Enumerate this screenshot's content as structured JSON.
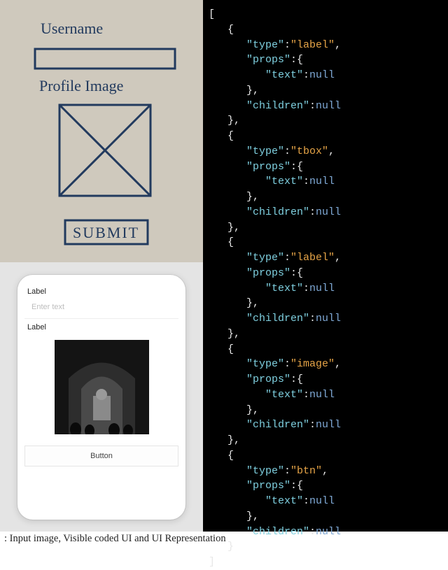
{
  "sketch": {
    "label_username": "Username",
    "label_profile_image": "Profile Image",
    "submit_button": "SUBMIT"
  },
  "phone_ui": {
    "label_1": "Label",
    "input_placeholder": "Enter text",
    "label_2": "Label",
    "button_text": "Button"
  },
  "code_tree": [
    {
      "type": "label",
      "props": {
        "text": null
      },
      "children": null
    },
    {
      "type": "tbox",
      "props": {
        "text": null
      },
      "children": null
    },
    {
      "type": "label",
      "props": {
        "text": null
      },
      "children": null
    },
    {
      "type": "image",
      "props": {
        "text": null
      },
      "children": null
    },
    {
      "type": "btn",
      "props": {
        "text": null
      },
      "children": null
    }
  ],
  "caption": ": Input image, Visible coded UI and UI Representation"
}
